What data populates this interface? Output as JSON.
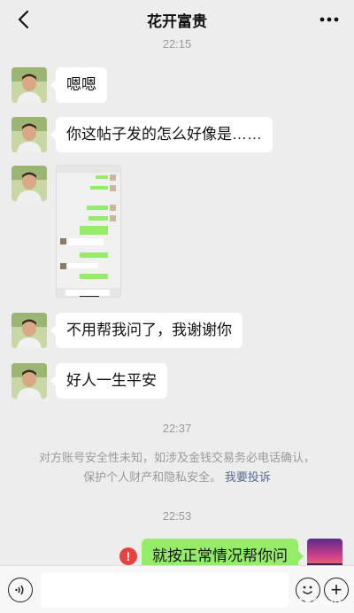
{
  "header": {
    "title": "花开富贵",
    "back_icon": "chevron-left-icon",
    "more_icon": "more-dots-icon"
  },
  "timestamps": {
    "t1": "22:15",
    "t2": "22:37",
    "t3": "22:53"
  },
  "messages": [
    {
      "side": "left",
      "type": "text",
      "text": "嗯嗯"
    },
    {
      "side": "left",
      "type": "text",
      "text": "你这帖子发的怎么好像是……"
    },
    {
      "side": "left",
      "type": "image",
      "alt": "chat screenshot thumbnail"
    },
    {
      "side": "left",
      "type": "text",
      "text": "不用帮我问了，我谢谢你"
    },
    {
      "side": "left",
      "type": "text",
      "text": "好人一生平安"
    },
    {
      "side": "right",
      "type": "text",
      "text": "就按正常情况帮你问",
      "status": "failed"
    }
  ],
  "notice": {
    "line1": "对方账号安全性未知，如涉及金钱交易务必电话确认，",
    "line2": "保护个人财产和隐私安全。",
    "link": "我要投诉"
  },
  "error_mark": "!",
  "input_bar": {
    "voice_icon": "voice-icon",
    "emoji_icon": "emoji-icon",
    "plus_label": "+"
  },
  "watermark": "HUARENJIE",
  "colors": {
    "background": "#ededed",
    "bubble_left": "#ffffff",
    "bubble_right": "#95ec69",
    "error": "#e64340",
    "link": "#576b95"
  }
}
